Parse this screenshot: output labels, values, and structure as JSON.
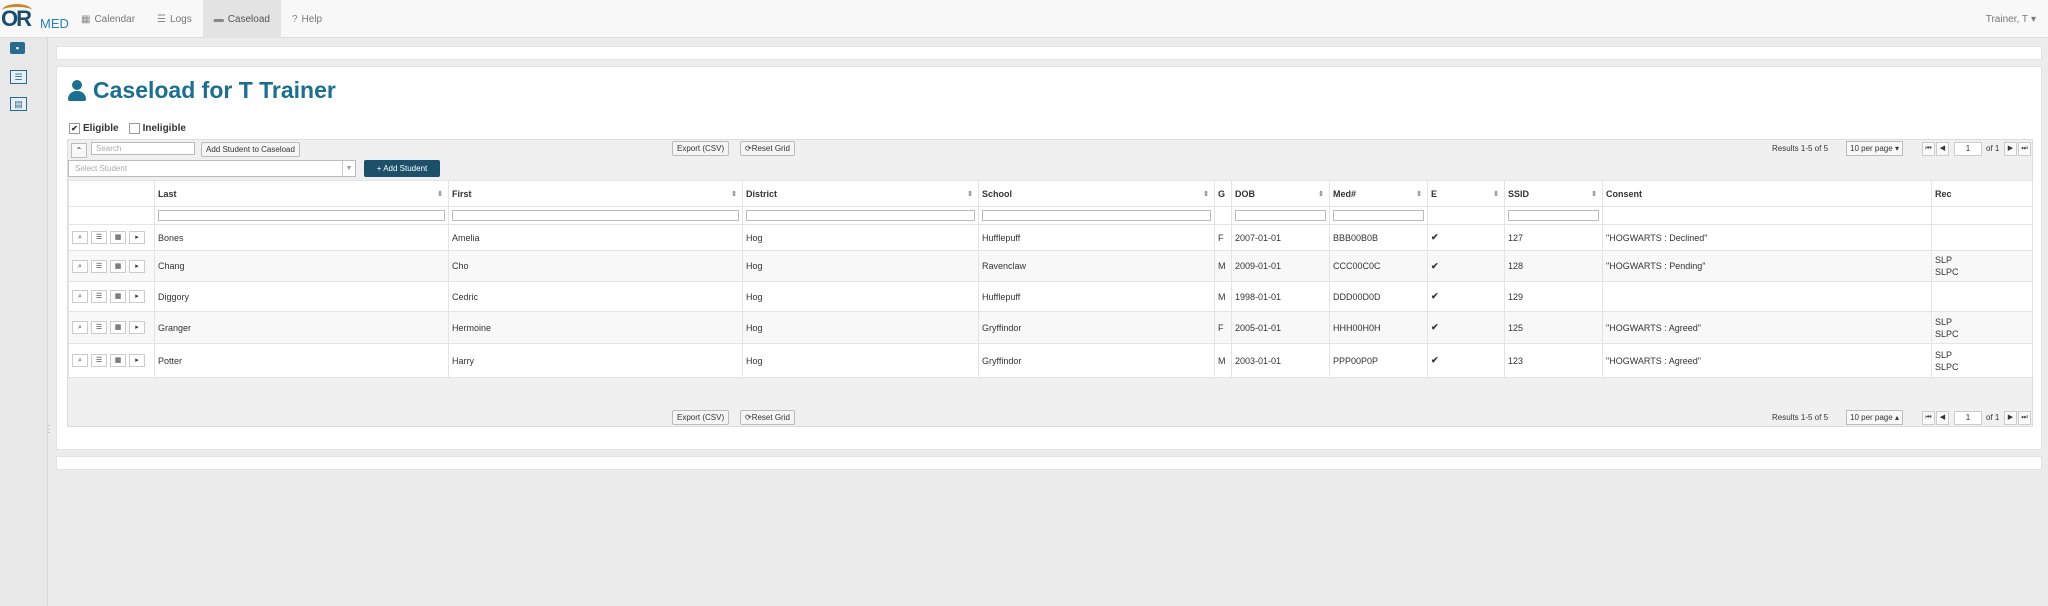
{
  "nav": {
    "logo_or": "OR",
    "logo_med": "MED",
    "items": [
      {
        "icon": "calendar-icon",
        "glyph": "▦",
        "label": "Calendar"
      },
      {
        "icon": "list-icon",
        "glyph": "☰",
        "label": "Logs"
      },
      {
        "icon": "briefcase-icon",
        "glyph": "▬",
        "label": "Caseload"
      },
      {
        "icon": "question-circle-icon",
        "glyph": "?",
        "label": "Help"
      }
    ],
    "user": "Trainer, T",
    "user_caret": "▾"
  },
  "page": {
    "title": "Caseload for T Trainer"
  },
  "filters": {
    "eligible_label": "Eligible",
    "eligible_checked": true,
    "ineligible_label": "Ineligible",
    "ineligible_checked": false
  },
  "toolbar": {
    "search_placeholder": "Search",
    "add_to_caseload": "Add Student to Caseload",
    "export": "Export (CSV)",
    "reset": "Reset Grid",
    "select_student_placeholder": "Select Student",
    "add_student": "+ Add Student",
    "results": "Results 1-5  of 5",
    "per_page": "10 per page",
    "page": "1",
    "of": "of 1"
  },
  "columns": [
    "",
    "Last",
    "First",
    "District",
    "School",
    "G",
    "DOB",
    "Med#",
    "E",
    "SSID",
    "Consent",
    "Rec"
  ],
  "rows": [
    {
      "last": "Bones",
      "first": "Amelia",
      "district": "Hog",
      "school": "Hufflepuff",
      "g": "F",
      "dob": "2007-01-01",
      "med": "BBB00B0B",
      "e": "✔",
      "ssid": "127",
      "consent": "\"HOGWARTS : Declined\"",
      "rec1": "",
      "rec2": ""
    },
    {
      "last": "Chang",
      "first": "Cho",
      "district": "Hog",
      "school": "Ravenclaw",
      "g": "M",
      "dob": "2009-01-01",
      "med": "CCC00C0C",
      "e": "✔",
      "ssid": "128",
      "consent": "\"HOGWARTS : Pending\"",
      "rec1": "SLP",
      "rec2": "SLPC"
    },
    {
      "last": "Diggory",
      "first": "Cedric",
      "district": "Hog",
      "school": "Hufflepuff",
      "g": "M",
      "dob": "1998-01-01",
      "med": "DDD00D0D",
      "e": "✔",
      "ssid": "129",
      "consent": "",
      "rec1": "",
      "rec2": ""
    },
    {
      "last": "Granger",
      "first": "Hermoine",
      "district": "Hog",
      "school": "Gryffindor",
      "g": "F",
      "dob": "2005-01-01",
      "med": "HHH00H0H",
      "e": "✔",
      "ssid": "125",
      "consent": "\"HOGWARTS : Agreed\"",
      "rec1": "SLP",
      "rec2": "SLPC"
    },
    {
      "last": "Potter",
      "first": "Harry",
      "district": "Hog",
      "school": "Gryffindor",
      "g": "M",
      "dob": "2003-01-01",
      "med": "PPP00P0P",
      "e": "✔",
      "ssid": "123",
      "consent": "\"HOGWARTS : Agreed\"",
      "rec1": "SLP",
      "rec2": "SLPC"
    }
  ],
  "colors": {
    "brand": "#1d6f8f",
    "add_button": "#1c4f6a",
    "check": "#2e8b57"
  }
}
